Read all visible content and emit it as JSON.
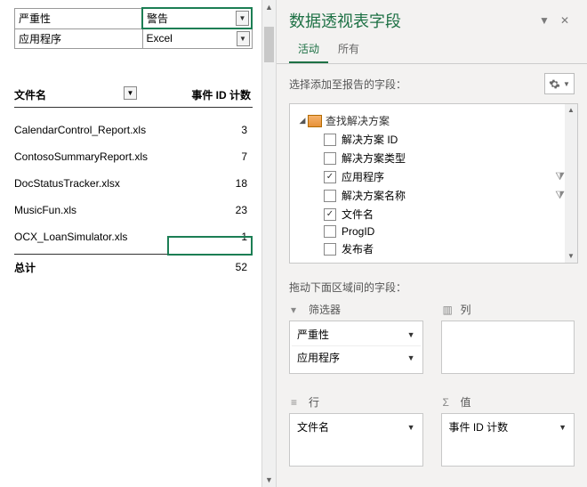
{
  "filters": [
    {
      "label": "严重性",
      "value": "警告"
    },
    {
      "label": "应用程序",
      "value": "Excel"
    }
  ],
  "headers": {
    "file": "文件名",
    "count": "事件 ID 计数"
  },
  "rows": [
    {
      "file": "CalendarControl_Report.xls",
      "count": 3
    },
    {
      "file": "ContosoSummaryReport.xls",
      "count": 7
    },
    {
      "file": "DocStatusTracker.xlsx",
      "count": 18
    },
    {
      "file": "MusicFun.xls",
      "count": 23
    },
    {
      "file": "OCX_LoanSimulator.xls",
      "count": 1
    }
  ],
  "total": {
    "label": "总计",
    "value": 52
  },
  "pane": {
    "title": "数据透视表字段",
    "tabs": {
      "active": "活动",
      "all": "所有"
    },
    "subhead": "选择添加至报告的字段：",
    "tree_label": "查找解决方案",
    "fields": [
      {
        "label": "解决方案 ID",
        "checked": false,
        "funnel": false
      },
      {
        "label": "解决方案类型",
        "checked": false,
        "funnel": false
      },
      {
        "label": "应用程序",
        "checked": true,
        "funnel": true
      },
      {
        "label": "解决方案名称",
        "checked": false,
        "funnel": true
      },
      {
        "label": "文件名",
        "checked": true,
        "funnel": false
      },
      {
        "label": "ProgID",
        "checked": false,
        "funnel": false
      },
      {
        "label": "发布者",
        "checked": false,
        "funnel": false
      }
    ],
    "drag_hint": "拖动下面区域间的字段：",
    "zones": {
      "filters": {
        "label": "筛选器",
        "items": [
          "严重性",
          "应用程序"
        ]
      },
      "columns": {
        "label": "列",
        "items": []
      },
      "rows": {
        "label": "行",
        "items": [
          "文件名"
        ]
      },
      "values": {
        "label": "值",
        "items": [
          "事件 ID 计数"
        ]
      }
    }
  }
}
